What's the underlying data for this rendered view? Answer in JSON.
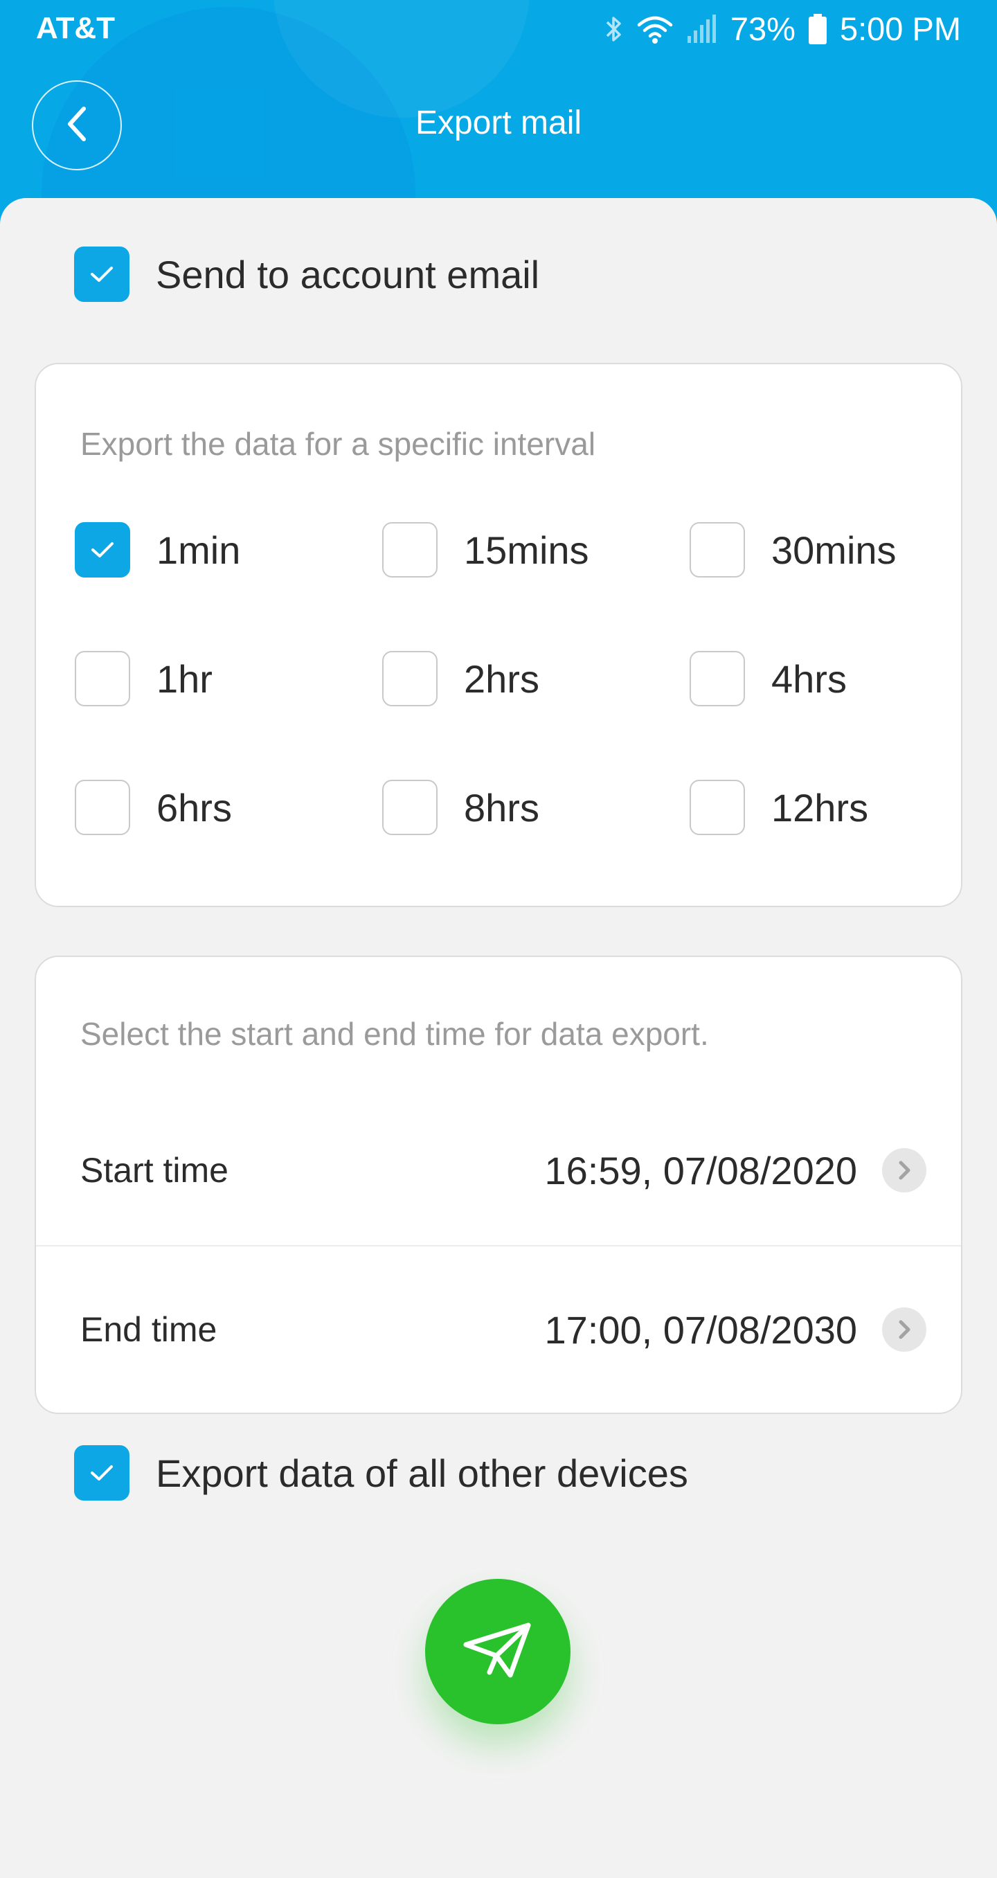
{
  "status_bar": {
    "carrier": "AT&T",
    "battery": "73%",
    "time": "5:00 PM",
    "icons": [
      "bluetooth-icon",
      "wifi-icon",
      "signal-icon",
      "battery-icon"
    ]
  },
  "header": {
    "title": "Export mail",
    "back_icon": "chevron-left-icon",
    "color": "#07a8e6"
  },
  "send_to_account": {
    "label": "Send to account email",
    "checked": true
  },
  "interval_card": {
    "hint": "Export the data for a specific interval",
    "options": [
      {
        "label": "1min",
        "checked": true
      },
      {
        "label": "15mins",
        "checked": false
      },
      {
        "label": "30mins",
        "checked": false
      },
      {
        "label": "1hr",
        "checked": false
      },
      {
        "label": "2hrs",
        "checked": false
      },
      {
        "label": "4hrs",
        "checked": false
      },
      {
        "label": "6hrs",
        "checked": false
      },
      {
        "label": "8hrs",
        "checked": false
      },
      {
        "label": "12hrs",
        "checked": false
      }
    ]
  },
  "time_card": {
    "hint": "Select the start and end time for data export.",
    "start": {
      "label": "Start time",
      "value": "16:59,  07/08/2020"
    },
    "end": {
      "label": "End time",
      "value": "17:00,  07/08/2030"
    }
  },
  "export_all": {
    "label": "Export data of all other devices",
    "checked": true
  },
  "send_button": {
    "icon": "paper-plane-icon",
    "color": "#2ac22c"
  },
  "accent_color": "#0ca7e4"
}
